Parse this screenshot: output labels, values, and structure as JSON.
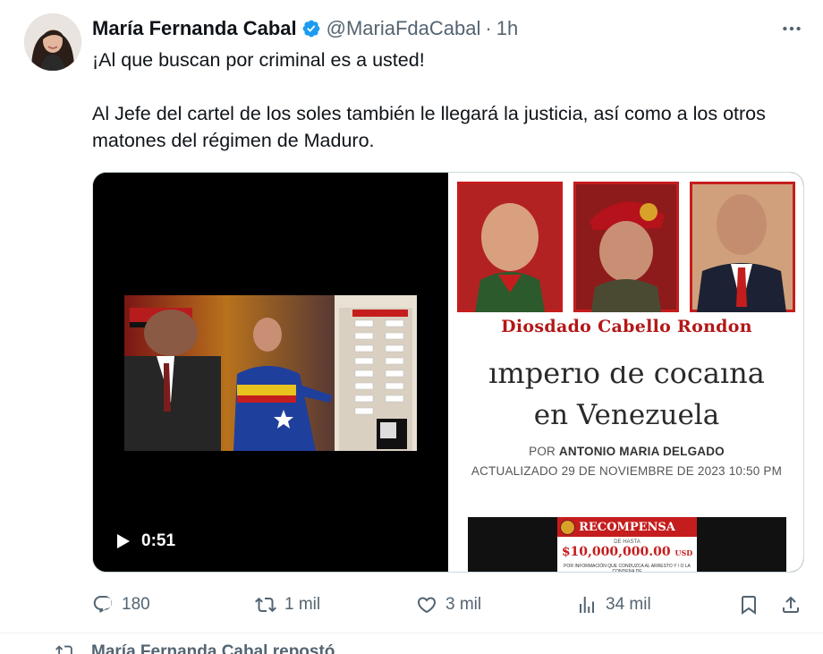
{
  "tweet": {
    "author_name": "María Fernanda Cabal",
    "handle": "@MariaFdaCabal",
    "separator": "·",
    "time": "1h",
    "text_line1": "¡Al que buscan por criminal es a usted!",
    "text_line2": "Al Jefe del cartel de los soles también le llegará la justicia, así como a los otros matones del régimen de Maduro."
  },
  "video": {
    "duration": "0:51"
  },
  "article_image": {
    "person_name": "Diosdado Cabello Rondon",
    "headline_top": "imperio de cocaína",
    "headline_bottom": "en Venezuela",
    "byline_prefix": "POR",
    "byline_author": "ANTONIO MARIA DELGADO",
    "updated": "ACTUALIZADO 29 DE NOVIEMBRE DE 2023 10:50 PM",
    "reward_title": "RECOMPENSA",
    "reward_upto": "DE HASTA",
    "reward_amount": "$10,000,000.00",
    "reward_currency": "USD",
    "reward_fine": "POR INFORMACIÓN QUE CONDUZCA AL ARRESTO Y / O LA CONDENA DE"
  },
  "actions": {
    "replies": "180",
    "reposts": "1 mil",
    "likes": "3 mil",
    "views": "34 mil"
  },
  "next_item": {
    "label": "María Fernanda Cabal repostó"
  },
  "colors": {
    "verified": "#1d9bf0",
    "muted": "#536471",
    "reward_red": "#c51d1d"
  },
  "icons": [
    "verified-badge-icon",
    "more-icon",
    "play-icon",
    "reply-icon",
    "repost-icon",
    "like-icon",
    "views-icon",
    "bookmark-icon",
    "share-icon"
  ]
}
